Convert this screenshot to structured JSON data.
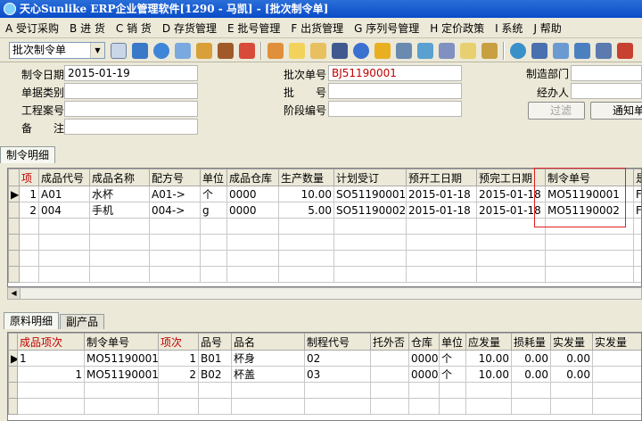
{
  "window": {
    "title": "天心Sunlike ERP企业管理软件[1290 - 马凯] - [批次制令单]"
  },
  "menu": [
    "A 受订采购",
    "B 进 货",
    "C 销 货",
    "D 存货管理",
    "E 批号管理",
    "F 出货管理",
    "G 序列号管理",
    "H 定价政策",
    "I 系统",
    "J 帮助"
  ],
  "toolbar": {
    "doc_type": "批次制令单",
    "icons": [
      "first-record-icon",
      "previous-icon",
      "phone-icon",
      "print-icon",
      "save-icon",
      "briefcase-icon",
      "house-icon",
      "people-icon",
      "mail-icon",
      "folder-icon",
      "arrow-icon",
      "help-icon",
      "dollar-icon",
      "keyboard-icon",
      "table-icon",
      "document-icon",
      "envelope-icon",
      "open-icon",
      "check-icon",
      "lock-icon",
      "network-icon",
      "monitor-icon",
      "notebook-icon",
      "exit-icon"
    ]
  },
  "form": {
    "order_date_label": "制令日期",
    "order_date": "2015-01-19",
    "doc_category_label": "单据类别",
    "doc_category": "",
    "project_no_label": "工程案号",
    "project_no": "",
    "remark_label": "备　　注",
    "remark": "",
    "batch_no_label": "批次单号",
    "batch_no": "BJ51190001",
    "lot_label": "批　　号",
    "lot": "",
    "stage_no_label": "阶段编号",
    "stage_no": "",
    "dept_label": "制造部门",
    "dept": "",
    "handler_label": "经办人",
    "handler": "",
    "filter_button": "过滤",
    "notify_button": "通知单"
  },
  "upper_tab": "制令明细",
  "upper_grid": {
    "headers": [
      "项",
      "成品代号",
      "成品名称",
      "配方号",
      "单位",
      "成品仓库",
      "生产数量",
      "计划受订",
      "预开工日期",
      "预完工日期",
      "制令单号",
      "是"
    ],
    "rows": [
      [
        "1",
        "A01",
        "水杯",
        "A01->",
        "个",
        "0000",
        "10.00",
        "SO51190001",
        "2015-01-18",
        "2015-01-18",
        "MO51190001",
        "F"
      ],
      [
        "2",
        "004",
        "手机",
        "004->",
        "g",
        "0000",
        "5.00",
        "SO51190002",
        "2015-01-18",
        "2015-01-18",
        "MO51190002",
        "F"
      ]
    ]
  },
  "lower_tabs": [
    "原料明细",
    "副产品"
  ],
  "lower_grid": {
    "headers": [
      "成品项次",
      "制令单号",
      "项次",
      "品号",
      "品名",
      "制程代号",
      "托外否",
      "仓库",
      "单位",
      "应发量",
      "损耗量",
      "实发量",
      "实发量"
    ],
    "rows": [
      [
        "1",
        "MO51190001",
        "1",
        "B01",
        "杯身",
        "02",
        "",
        "0000",
        "个",
        "10.00",
        "0.00",
        "0.00",
        ""
      ],
      [
        "1",
        "MO51190001",
        "2",
        "B02",
        "杯盖",
        "03",
        "",
        "0000",
        "个",
        "10.00",
        "0.00",
        "0.00",
        ""
      ]
    ]
  },
  "colors": {
    "titlebar": "#0a4cc8",
    "header_red": "#c00000",
    "batch_no_red": "#c00000",
    "highlight_box": "#e02020"
  }
}
